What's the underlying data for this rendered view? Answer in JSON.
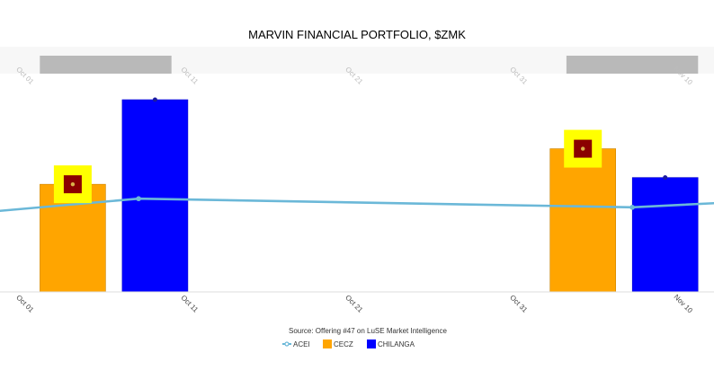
{
  "chart_data": {
    "type": "bar",
    "title": "MARVIN FINANCIAL PORTFOLIO, $ZMK",
    "source": "Source: Offering #47 on LuSE Market Intelligence",
    "xlabel": "",
    "ylabel": "",
    "x_ticks": [
      "Oct 01",
      "Oct 11",
      "Oct 21",
      "Oct 31",
      "Nov 10"
    ],
    "ylim": [
      0,
      100
    ],
    "grid": false,
    "legend_position": "bottom",
    "series": [
      {
        "name": "ACEI",
        "kind": "line",
        "color": "#6bb8d8",
        "points": [
          {
            "x": "2020-09-28",
            "y": 41
          },
          {
            "x": "2020-10-08",
            "y": 48.5
          },
          {
            "x": "2020-11-07",
            "y": 44
          },
          {
            "x": "2020-11-14",
            "y": 47
          }
        ]
      },
      {
        "name": "CECZ",
        "kind": "bar",
        "color": "#ffa500",
        "points": [
          {
            "x": "2020-10-04",
            "y": 56
          },
          {
            "x": "2020-11-04",
            "y": 74.5
          }
        ]
      },
      {
        "name": "CHILANGA",
        "kind": "bar",
        "color": "#0000ff",
        "points": [
          {
            "x": "2020-10-09",
            "y": 100
          },
          {
            "x": "2020-11-09",
            "y": 59.5
          }
        ]
      }
    ],
    "annotations": [
      {
        "type": "marker",
        "series": "CECZ",
        "x": "2020-10-04",
        "color": "#ffff00",
        "inner_color": "#8b0000"
      },
      {
        "type": "marker",
        "series": "CECZ",
        "x": "2020-11-04",
        "color": "#ffff00",
        "inner_color": "#8b0000"
      }
    ],
    "range_selector": {
      "x_ticks": [
        "Oct 01",
        "Oct 11",
        "Oct 21",
        "Oct 31",
        "Nov 10"
      ],
      "selected_ranges": [
        {
          "from": "2020-10-02",
          "to": "2020-10-10"
        },
        {
          "from": "2020-11-03",
          "to": "2020-11-11"
        }
      ]
    }
  }
}
